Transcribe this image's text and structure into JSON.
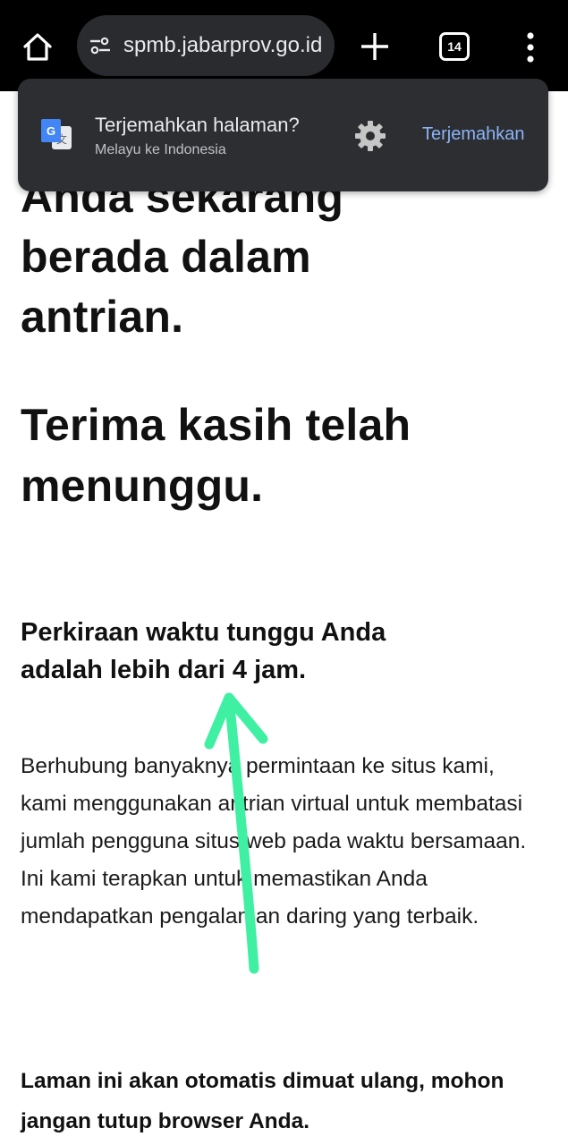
{
  "browser": {
    "url": "spmb.jabarprov.go.id",
    "tab_count": "14",
    "icons": [
      "home-icon",
      "site-settings-icon",
      "plus-icon",
      "tab-switcher-icon",
      "more-vert-icon"
    ]
  },
  "translate_bar": {
    "title": "Terjemahkan halaman?",
    "subtitle": "Melayu ke Indonesia",
    "action_label": "Terjemahkan",
    "icons": [
      "google-translate-icon",
      "gear-icon"
    ]
  },
  "page": {
    "heading_lines": [
      "Anda sekarang",
      "berada dalam",
      "antrian."
    ],
    "thanks_lines": [
      "Terima kasih telah",
      "menunggu."
    ],
    "wait_lines": [
      "Perkiraan waktu tunggu Anda",
      "adalah lebih dari 4 jam."
    ],
    "paragraph": "Berhubung banyaknya permintaan ke situs kami, kami menggunakan antrian virtual untuk membatasi jumlah pengguna situs web pada waktu bersamaan. Ini kami terapkan untuk memastikan Anda mendapatkan pengalaman daring yang terbaik.",
    "note": "Laman ini akan otomatis dimuat ulang, mohon jangan tutup browser Anda."
  },
  "colors": {
    "toolbar_bg": "#000000",
    "url_pill_bg": "#2a2b2f",
    "translate_bar_bg": "#2d2e31",
    "translate_action": "#8ab4f8",
    "annotation_arrow": "#3ff0a3"
  }
}
